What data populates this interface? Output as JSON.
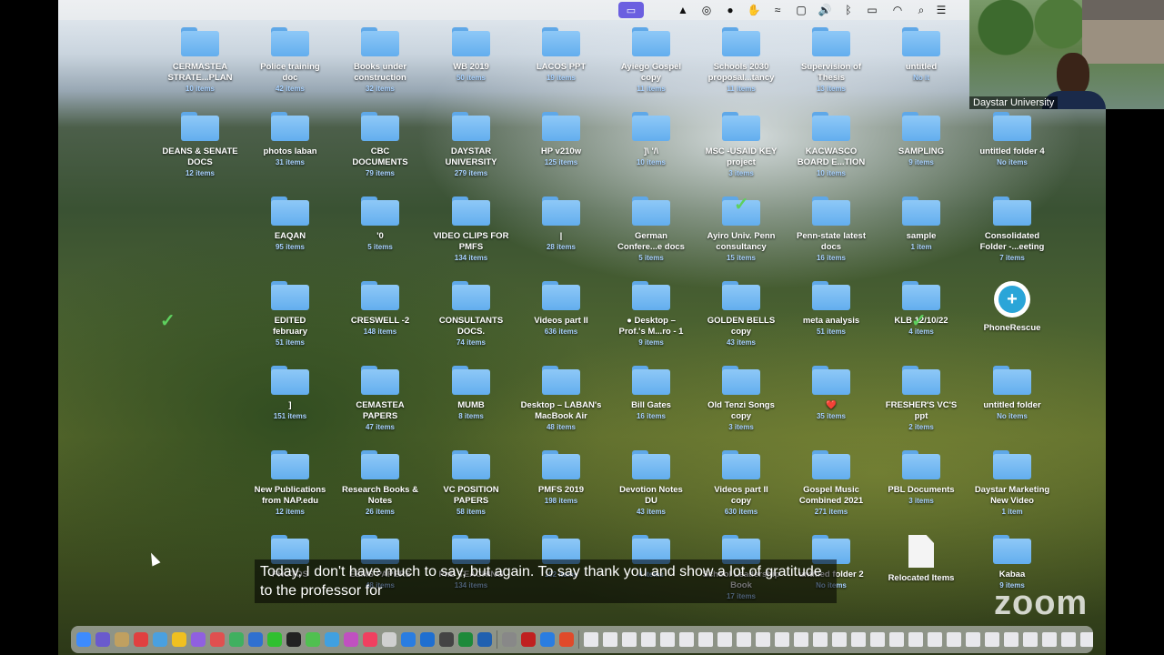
{
  "menubar": {
    "apple": "",
    "zoom_icon": "zoom-screen-share-icon",
    "status_icons": [
      "notch-icon",
      "creative-cloud-icon",
      "steam-icon",
      "hand-icon",
      "wind-icon",
      "mirror-icon",
      "volume-icon",
      "bluetooth-icon",
      "battery-icon",
      "wifi-icon",
      "search-icon",
      "control-center-icon"
    ]
  },
  "participant": {
    "name": "Daystar University"
  },
  "caption": {
    "text": "Today, I don't have much to say, but again. To say thank you and show a lot of gratitude to the professor for"
  },
  "zoom_logo": "zoom",
  "desktop": {
    "items": [
      {
        "name": "CERMASTEA\nSTRATE...PLAN",
        "sub": "10 items"
      },
      {
        "name": "Police training\ndoc",
        "sub": "42 items"
      },
      {
        "name": "Books under\nconstruction",
        "sub": "32 items"
      },
      {
        "name": "WB 2019",
        "sub": "50 items"
      },
      {
        "name": "LACOS PPT",
        "sub": "19 items"
      },
      {
        "name": "Ayiego Gospel\ncopy",
        "sub": "11 items"
      },
      {
        "name": "Schools 2030\nproposal...tancy",
        "sub": "11 items"
      },
      {
        "name": "Supervision of\nThesis",
        "sub": "13 items"
      },
      {
        "name": "untitled",
        "sub": "No it"
      },
      {
        "name": "DEANS & SENATE\nDOCS",
        "sub": "12 items"
      },
      {
        "name": "photos laban",
        "sub": "31 items"
      },
      {
        "name": "CBC\nDOCUMENTS",
        "sub": "79 items"
      },
      {
        "name": "DAYSTAR\nUNIVERSITY",
        "sub": "279 items"
      },
      {
        "name": "HP v210w",
        "sub": "125 items"
      },
      {
        "name": "]\\ '/\\",
        "sub": "10 items"
      },
      {
        "name": "MSC -USAID KEY\nproject",
        "sub": "3 items"
      },
      {
        "name": "KACWASCO\nBOARD E...TION",
        "sub": "10 items"
      },
      {
        "name": "SAMPLING",
        "sub": "9 items"
      },
      {
        "name": "untitled folder 4",
        "sub": "No items"
      },
      {
        "name": "EAQAN",
        "sub": "95 items"
      },
      {
        "name": "'0",
        "sub": "5 items"
      },
      {
        "name": "VIDEO CLIPS FOR\nPMFS",
        "sub": "134 items"
      },
      {
        "name": "|",
        "sub": "28 items"
      },
      {
        "name": "German\nConfere...e docs",
        "sub": "5 items"
      },
      {
        "name": "Ayiro Univ. Penn\nconsultancy",
        "sub": "15 items"
      },
      {
        "name": "Penn-state latest\ndocs",
        "sub": "16 items"
      },
      {
        "name": "sample",
        "sub": "1 item"
      },
      {
        "name": "Consolidated\nFolder -...eeting",
        "sub": "7 items"
      },
      {
        "name": "EDITED\nfebruary",
        "sub": "51 items"
      },
      {
        "name": "CRESWELL -2",
        "sub": "148 items"
      },
      {
        "name": "CONSULTANTS\nDOCS.",
        "sub": "74 items"
      },
      {
        "name": "Videos part II",
        "sub": "636 items"
      },
      {
        "name": "● Desktop –\nProf.'s M...ro - 1",
        "sub": "9 items"
      },
      {
        "name": "GOLDEN BELLS\ncopy",
        "sub": "43 items"
      },
      {
        "name": "meta analysis",
        "sub": "51 items"
      },
      {
        "name": "KLB 12/10/22",
        "sub": "4 items"
      },
      {
        "name": "PhoneRescue",
        "sub": ""
      },
      {
        "name": "]",
        "sub": "151 items"
      },
      {
        "name": "CEMASTEA\nPAPERS",
        "sub": "47 items"
      },
      {
        "name": "MUMB",
        "sub": "8 items"
      },
      {
        "name": "Desktop – LABAN's\nMacBook Air",
        "sub": "48 items"
      },
      {
        "name": "Bill Gates",
        "sub": "16 items"
      },
      {
        "name": "Old Tenzi Songs\ncopy",
        "sub": "3 items"
      },
      {
        "name": "❤️",
        "sub": "35 items"
      },
      {
        "name": "FRESHER'S VC'S\nppt",
        "sub": "2 items"
      },
      {
        "name": "untitled folder",
        "sub": "No items"
      },
      {
        "name": "New Publications\nfrom NAP.edu",
        "sub": "12 items"
      },
      {
        "name": "Research Books &\nNotes",
        "sub": "26 items"
      },
      {
        "name": "VC POSITION\nPAPERS",
        "sub": "58 items"
      },
      {
        "name": "PMFS 2019",
        "sub": "198 items"
      },
      {
        "name": "Devotion Notes\nDU",
        "sub": "43 items"
      },
      {
        "name": "Videos part II\ncopy",
        "sub": "630 items"
      },
      {
        "name": "Gospel Music\nCombined 2021",
        "sub": "271 items"
      },
      {
        "name": "PBL Documents",
        "sub": "3 items"
      },
      {
        "name": "Daystar Marketing\nNew Video",
        "sub": "1 item"
      },
      {
        "name": "PHOTOS",
        "sub": ""
      },
      {
        "name": "EEMS PAPERS",
        "sub": "48 items"
      },
      {
        "name": "PhD TEACHING",
        "sub": "134 items"
      },
      {
        "name": "",
        "sub": "102 items"
      },
      {
        "name": "",
        "sub": "4 items"
      },
      {
        "name": "School Leadership\nBook",
        "sub": "17 items"
      },
      {
        "name": "untitled folder 2",
        "sub": "No items"
      },
      {
        "name": "Relocated Items",
        "sub": ""
      },
      {
        "name": "Kabaa",
        "sub": "9 items"
      }
    ]
  }
}
